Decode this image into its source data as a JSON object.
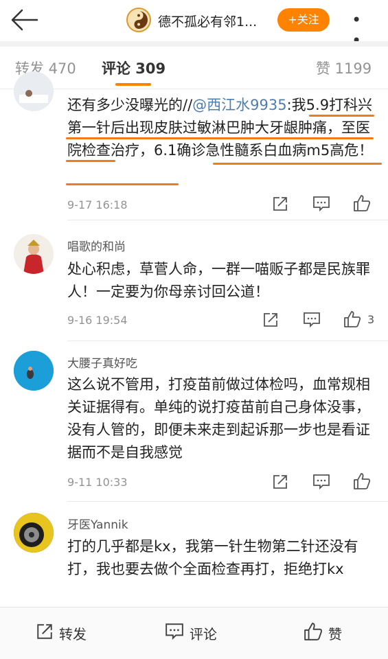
{
  "header": {
    "title": "德不孤必有邻1...",
    "follow_label": "+关注",
    "more_label": "• • •"
  },
  "tabs": [
    {
      "label": "转发 470"
    },
    {
      "label": "评论 309"
    },
    {
      "label": "赞 1199"
    }
  ],
  "comments": [
    {
      "prefix": "还有多少没曝光的//",
      "mention": "@西江水9935",
      "body": ":我5.9打科兴第一针后出现皮肤过敏淋巴肿大牙龈肿痛，至医院检查治疗，6.1确诊急性髓系白血病m5高危！",
      "time": "9-17 16:18",
      "likes": ""
    },
    {
      "user": "唱歌的和尚",
      "body": "处心积虑，草菅人命，一群一喵贩子都是民族罪人！一定要为你母亲讨回公道！",
      "time": "9-16 19:54",
      "likes": "3"
    },
    {
      "user": "大腰子真好吃",
      "body": "这么说不管用，打疫苗前做过体检吗，血常规相关证据得有。单纯的说打疫苗前自己身体没事，没有人管的，即便未来走到起诉那一步也是看证据而不是自我感觉",
      "time": "9-11 10:33",
      "likes": ""
    },
    {
      "user": "牙医Yannik",
      "body": "打的几乎都是kx，我第一针生物第二针还没有打，我也要去做个全面检查再打，拒绝打kx",
      "time": "",
      "likes": ""
    }
  ],
  "bottom_bar": {
    "repost": "转发",
    "comment": "评论",
    "like": "赞"
  },
  "colors": {
    "accent": "#ff8200",
    "mention": "#507daf",
    "annotation": "#f07b1a"
  }
}
